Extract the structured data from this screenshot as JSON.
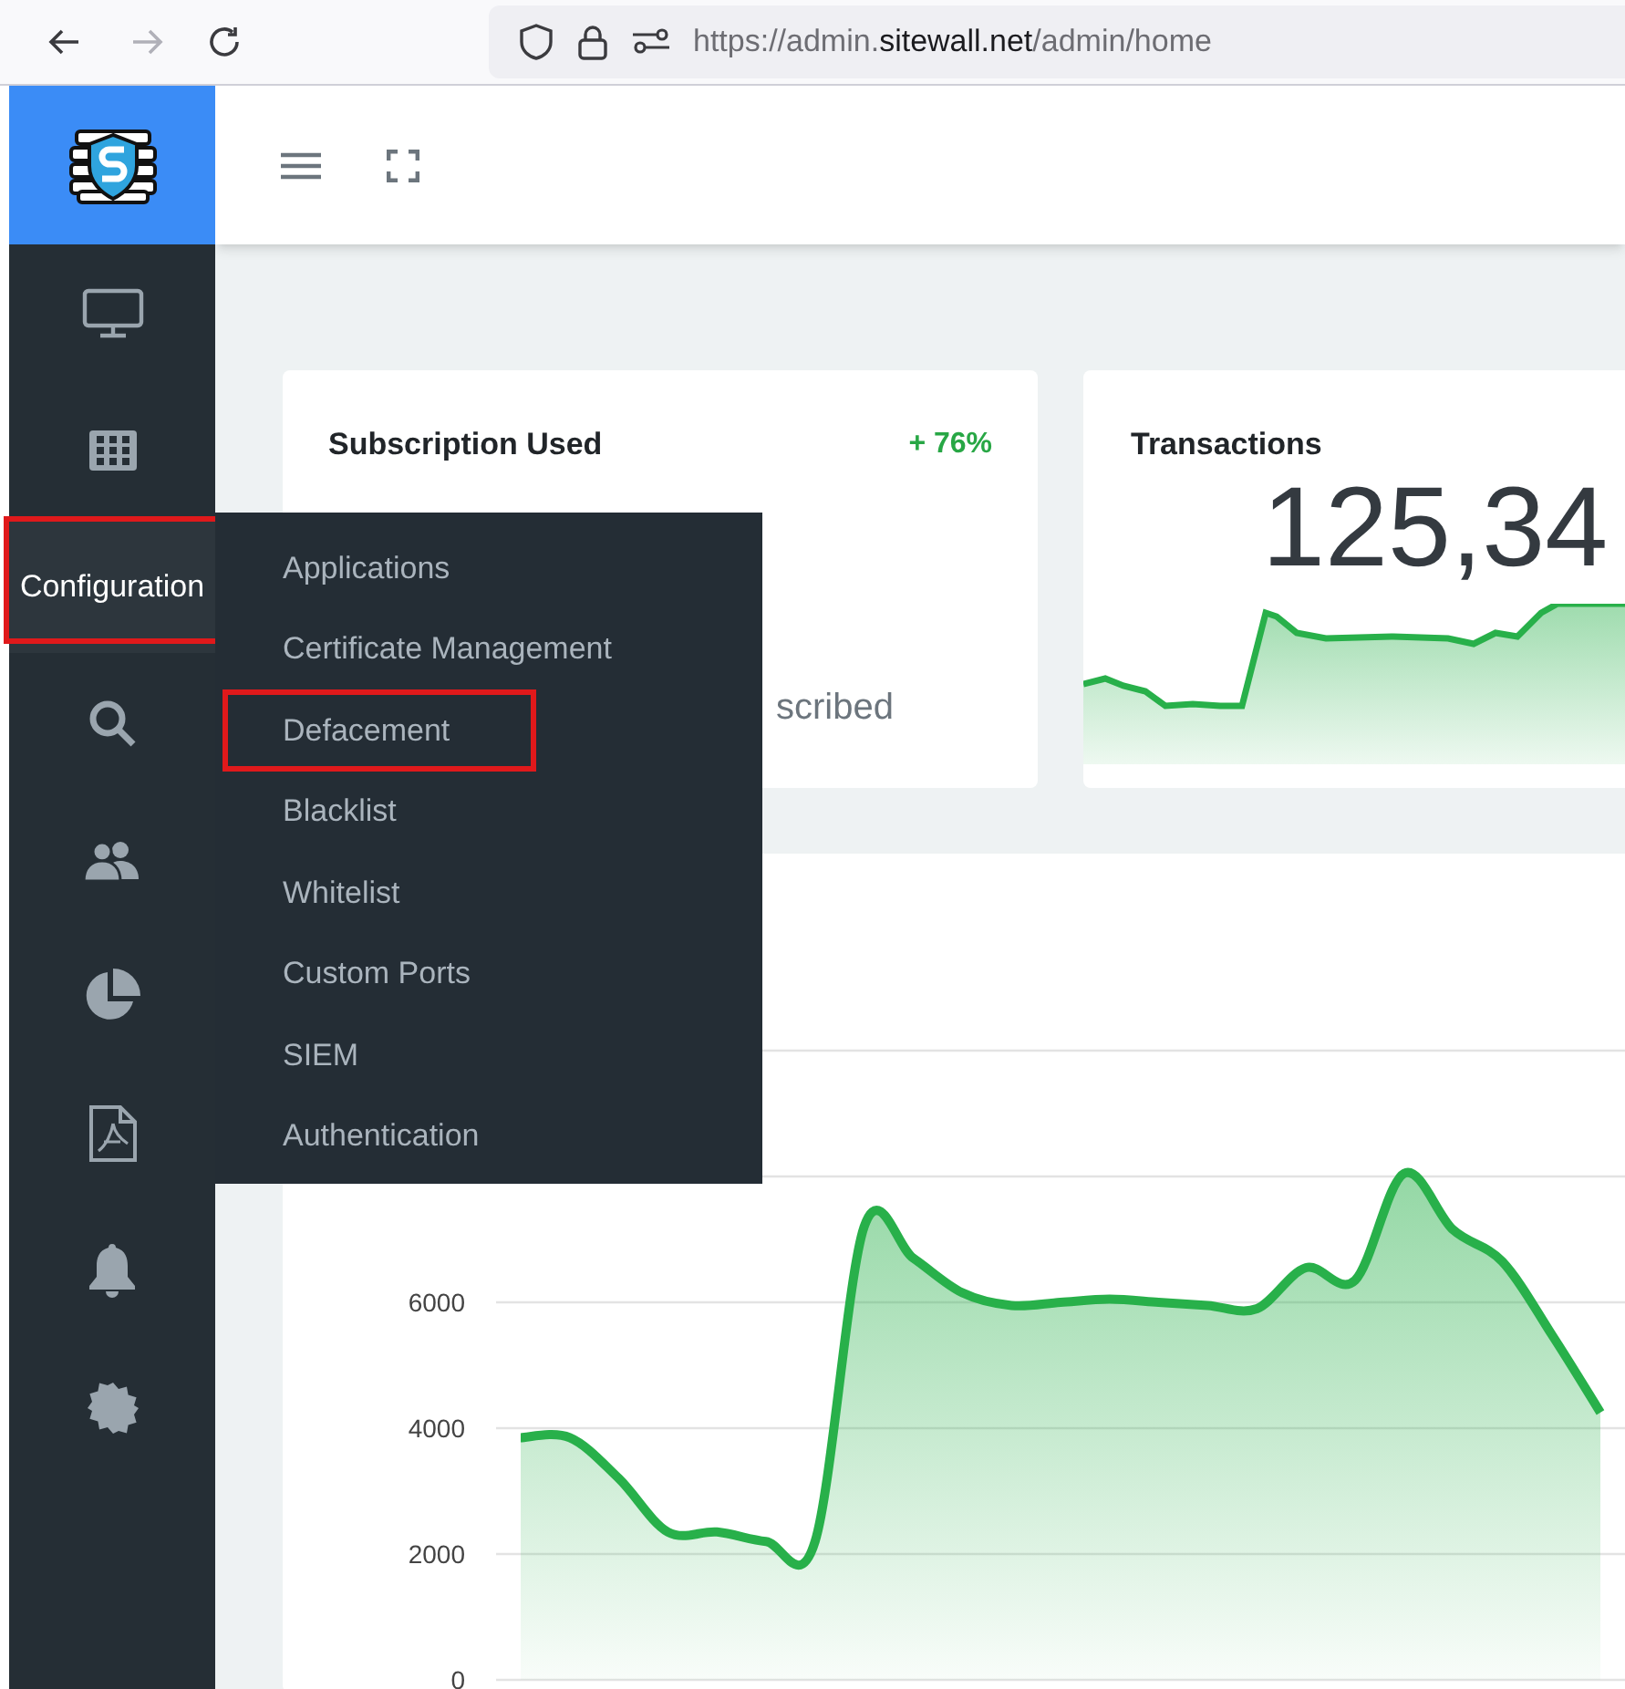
{
  "browser": {
    "url_prefix": "https://admin.",
    "url_domain": "sitewall.net",
    "url_path": "/admin/home",
    "forward_disabled": true
  },
  "sidebar": {
    "menu_item": {
      "label": "Configuration",
      "selected": true,
      "highlighted": true
    }
  },
  "submenu": {
    "items": [
      {
        "label": "Applications",
        "highlighted": false
      },
      {
        "label": "Certificate Management",
        "highlighted": false
      },
      {
        "label": "Defacement",
        "highlighted": true
      },
      {
        "label": "Blacklist",
        "highlighted": false
      },
      {
        "label": "Whitelist",
        "highlighted": false
      },
      {
        "label": "Custom Ports",
        "highlighted": false
      },
      {
        "label": "SIEM",
        "highlighted": false
      },
      {
        "label": "Authentication",
        "highlighted": false
      }
    ]
  },
  "cards": [
    {
      "title": "Subscription Used",
      "change": "+ 76%",
      "caption": "scribed"
    },
    {
      "title": "Transactions",
      "value": "125,34"
    }
  ],
  "traffic_chart": {
    "chart_data": {
      "type": "area",
      "ylim": [
        0,
        10000
      ],
      "yticks": [
        0,
        2000,
        4000,
        6000
      ],
      "grid": true,
      "series": [
        {
          "color": "#28b04a",
          "values": [
            3850,
            3850,
            3200,
            2350,
            2350,
            2200,
            2200,
            7200,
            6700,
            6150,
            5950,
            6000,
            6050,
            6000,
            5950,
            5900,
            6550,
            6350,
            8050,
            7150,
            6650,
            5500,
            4250
          ]
        }
      ]
    }
  }
}
